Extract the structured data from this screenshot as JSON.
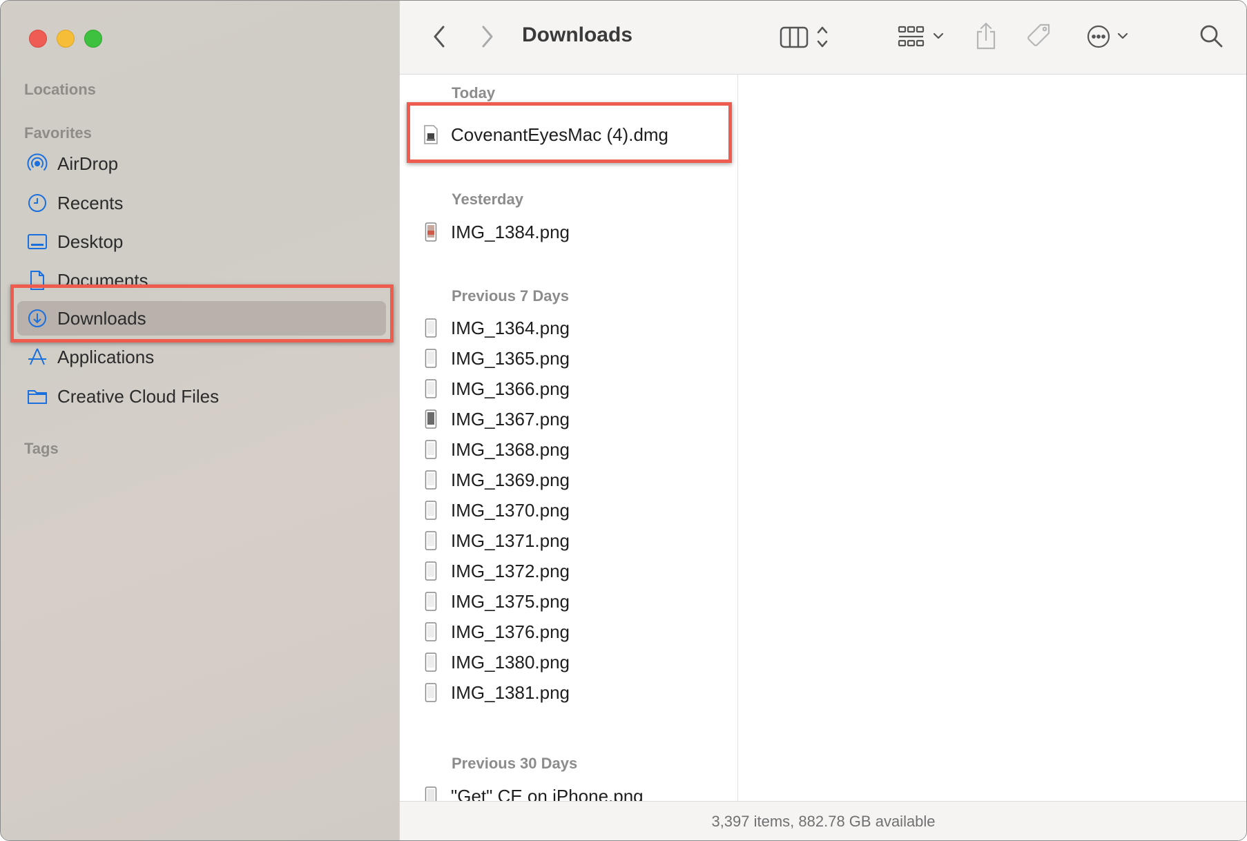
{
  "window": {
    "title": "Downloads"
  },
  "sidebar": {
    "locations_label": "Locations",
    "favorites_label": "Favorites",
    "tags_label": "Tags",
    "items": [
      {
        "label": "AirDrop",
        "icon": "airdrop-icon"
      },
      {
        "label": "Recents",
        "icon": "clock-icon"
      },
      {
        "label": "Desktop",
        "icon": "desktop-icon"
      },
      {
        "label": "Documents",
        "icon": "document-icon"
      },
      {
        "label": "Downloads",
        "icon": "download-icon",
        "selected": true
      },
      {
        "label": "Applications",
        "icon": "applications-icon"
      },
      {
        "label": "Creative Cloud Files",
        "icon": "folder-icon"
      }
    ]
  },
  "groups": {
    "today": {
      "label": "Today",
      "files": [
        "CovenantEyesMac (4).dmg"
      ]
    },
    "yesterday": {
      "label": "Yesterday",
      "files": [
        "IMG_1384.png"
      ]
    },
    "previous7": {
      "label": "Previous 7 Days",
      "files": [
        "IMG_1364.png",
        "IMG_1365.png",
        "IMG_1366.png",
        "IMG_1367.png",
        "IMG_1368.png",
        "IMG_1369.png",
        "IMG_1370.png",
        "IMG_1371.png",
        "IMG_1372.png",
        "IMG_1375.png",
        "IMG_1376.png",
        "IMG_1380.png",
        "IMG_1381.png"
      ]
    },
    "previous30": {
      "label": "Previous 30 Days",
      "files": [
        "\"Get\" CE on iPhone.png"
      ]
    }
  },
  "status": {
    "text": "3,397 items, 882.78 GB available"
  },
  "colors": {
    "accent": "#1a6fde",
    "highlight": "#ee5b4f"
  }
}
